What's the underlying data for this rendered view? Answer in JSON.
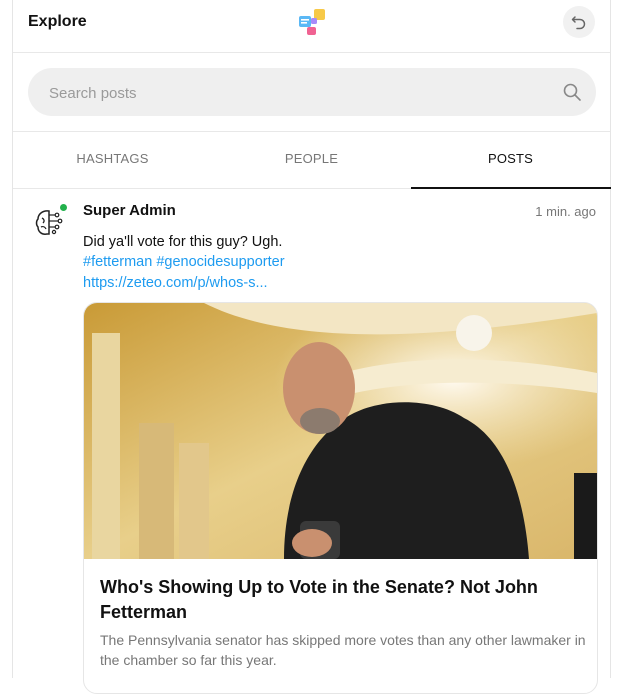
{
  "header": {
    "title": "Explore",
    "logo_icon": "chat-bubbles-logo-icon",
    "undo_icon": "undo-icon"
  },
  "search": {
    "placeholder": "Search posts",
    "value": "",
    "icon": "search-icon"
  },
  "tabs": [
    {
      "label": "HASHTAGS",
      "active": false
    },
    {
      "label": "PEOPLE",
      "active": false
    },
    {
      "label": "POSTS",
      "active": true
    }
  ],
  "post": {
    "author": "Super Admin",
    "time": "1 min. ago",
    "text": "Did ya'll vote for this guy? Ugh.",
    "hashtags": [
      "#fetterman",
      "#genocidesupporter"
    ],
    "link": "https://zeteo.com/p/whos-s...",
    "preview": {
      "title": "Who's Showing Up to Vote in the Senate? Not John Fetterman",
      "description": "The Pennsylvania senator has skipped more votes than any other lawmaker in the chamber so far this year."
    },
    "colors": {
      "link": "#1d9bf0",
      "online": "#22b14c"
    }
  }
}
